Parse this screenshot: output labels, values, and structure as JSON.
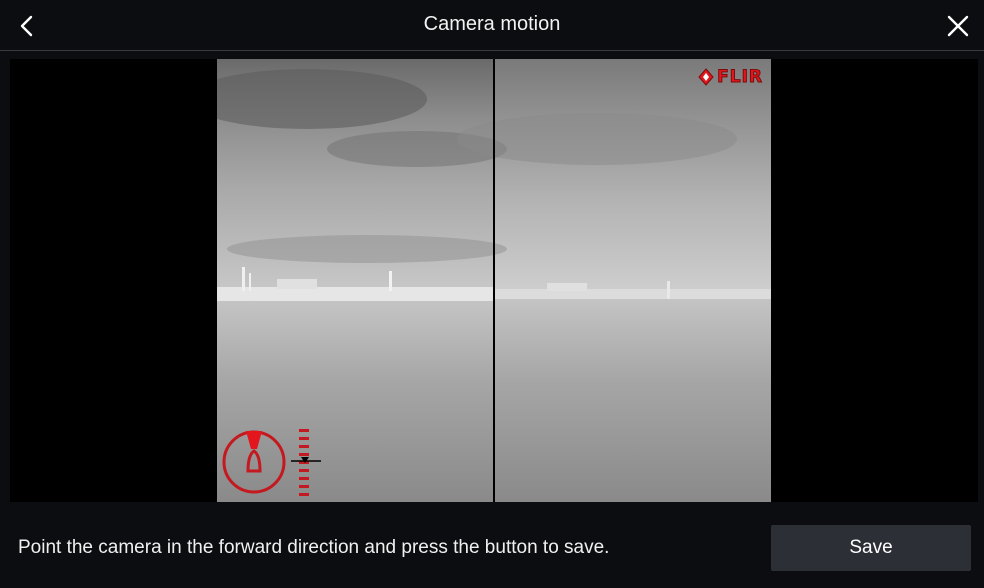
{
  "header": {
    "title": "Camera motion",
    "back_icon": "chevron-left-icon",
    "close_icon": "close-icon"
  },
  "video": {
    "overlay_brand": "FLIR",
    "overlay_icon": "flir-diamond-icon",
    "compass_icon": "boat-heading-icon",
    "accent_color": "#e3161d"
  },
  "footer": {
    "instruction": "Point the camera in the forward direction and press the button to save.",
    "save_label": "Save"
  }
}
